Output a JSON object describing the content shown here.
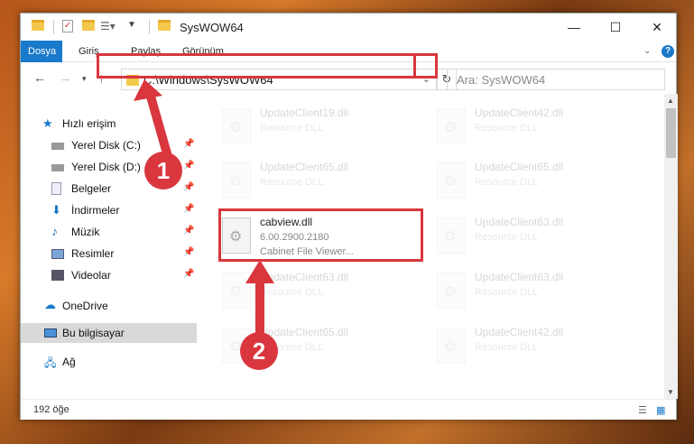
{
  "window": {
    "title": "SysWOW64"
  },
  "ribbon": {
    "tabs": [
      "Dosya",
      "Giriş",
      "Paylaş",
      "Görünüm"
    ],
    "help": "?"
  },
  "address": {
    "path": "C:\\Windows\\SysWOW64",
    "search_placeholder": "Ara: SysWOW64"
  },
  "sidebar": {
    "quick_access": "Hızlı erişim",
    "items": [
      {
        "label": "Yerel Disk (C:)",
        "icon": "drive-icon"
      },
      {
        "label": "Yerel Disk (D:)",
        "icon": "drive-icon"
      },
      {
        "label": "Belgeler",
        "icon": "documents-icon"
      },
      {
        "label": "İndirmeler",
        "icon": "downloads-icon"
      },
      {
        "label": "Müzik",
        "icon": "music-icon"
      },
      {
        "label": "Resimler",
        "icon": "pictures-icon"
      },
      {
        "label": "Videolar",
        "icon": "videos-icon"
      }
    ],
    "onedrive": "OneDrive",
    "this_pc": "Bu bilgisayar",
    "network": "Ağ"
  },
  "files": [
    {
      "name": "UpdateClient19.dll",
      "type": "Resource DLL"
    },
    {
      "name": "UpdateClient42.dll",
      "type": "Resource DLL"
    },
    {
      "name": "UpdateClient65.dll",
      "type": "Resource DLL"
    },
    {
      "name": "UpdateClient65.dll",
      "type": "Resource DLL"
    },
    {
      "name": "cabview.dll",
      "version": "6.00.2900.2180",
      "type": "Cabinet File Viewer..."
    },
    {
      "name": "UpdateClient63.dll",
      "type": "Resource DLL"
    },
    {
      "name": "UpdateClient63.dll",
      "type": "Resource DLL"
    },
    {
      "name": "UpdateClient63.dll",
      "type": "Resource DLL"
    },
    {
      "name": "UpdateClient65.dll",
      "type": "Resource DLL"
    },
    {
      "name": "UpdateClient42.dll",
      "type": "Resource DLL"
    }
  ],
  "status": {
    "count": "192 öğe"
  },
  "annotations": {
    "step1": "1",
    "step2": "2"
  },
  "colors": {
    "accent": "#1979ca",
    "highlight": "#d9363e"
  }
}
